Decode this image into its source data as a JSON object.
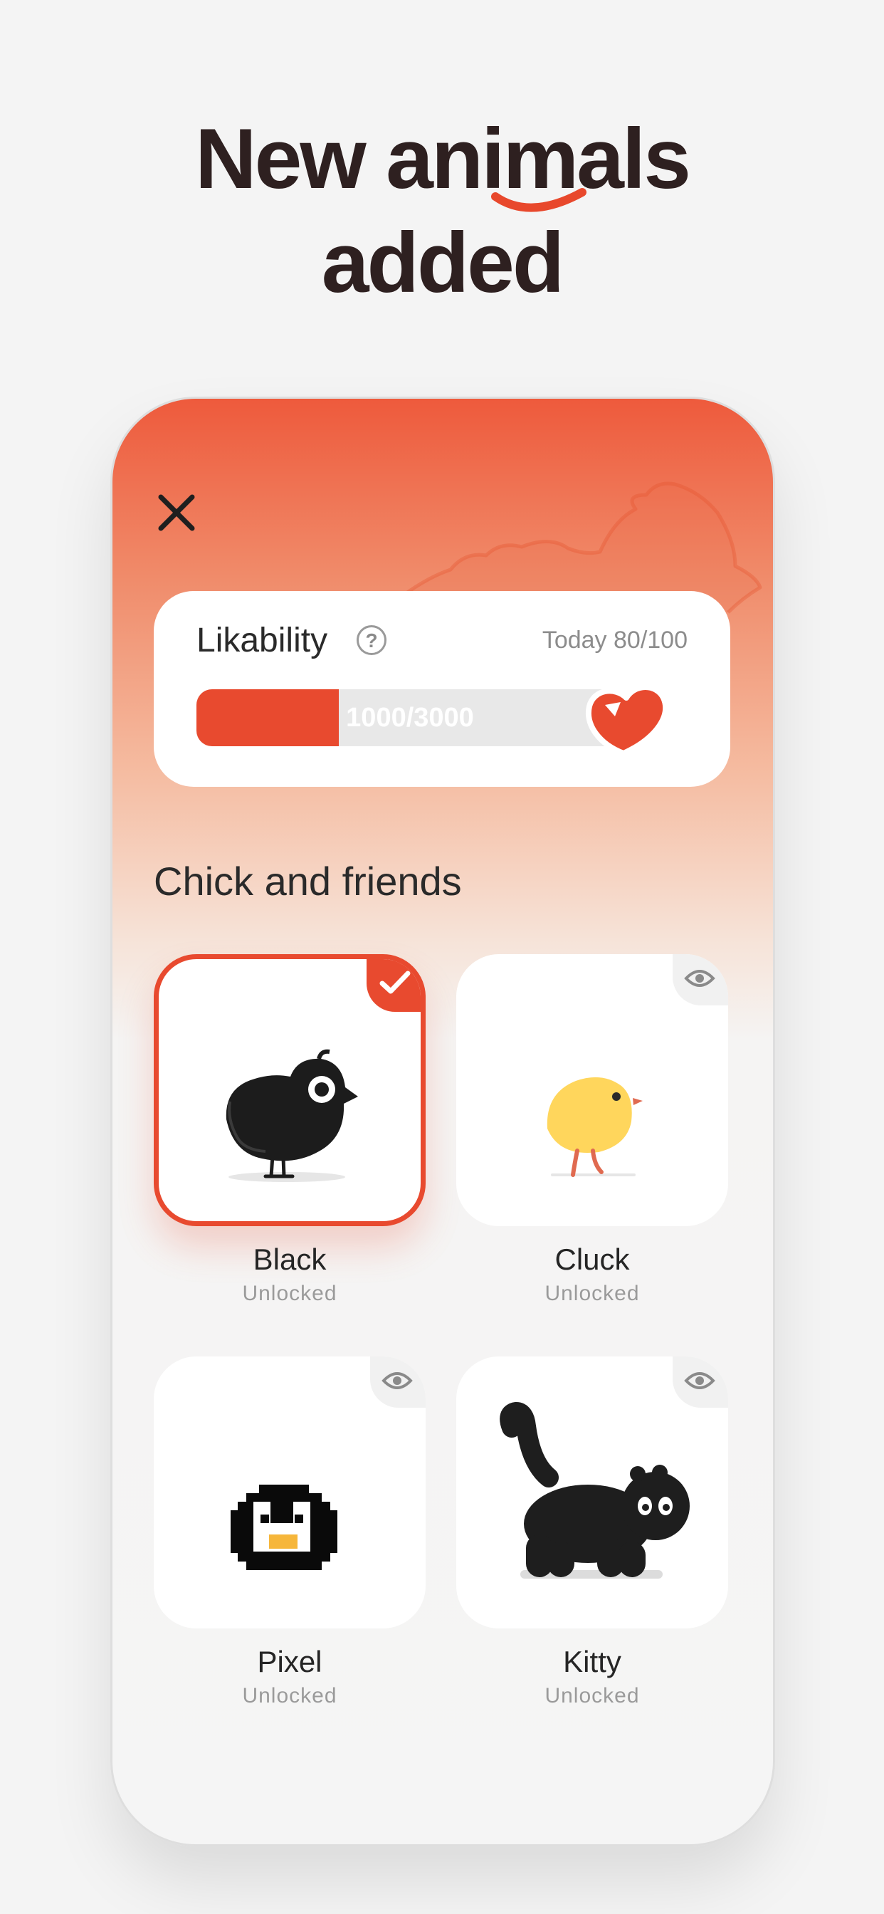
{
  "headline": {
    "line1": "New animals",
    "line2": "added"
  },
  "likability": {
    "title": "Likability",
    "today_label": "Today 80/100",
    "progress_text": "1000/3000",
    "progress_fraction": 0.3333
  },
  "section_title": "Chick and friends",
  "animals": [
    {
      "name": "Black",
      "status": "Unlocked",
      "selected": true
    },
    {
      "name": "Cluck",
      "status": "Unlocked",
      "selected": false
    },
    {
      "name": "Pixel",
      "status": "Unlocked",
      "selected": false
    },
    {
      "name": "Kitty",
      "status": "Unlocked",
      "selected": false
    }
  ],
  "icons": {
    "close": "close-icon",
    "help": "question-icon",
    "heart": "heart-icon",
    "check": "check-icon",
    "preview": "eye-icon"
  },
  "colors": {
    "accent": "#e84a2f",
    "text": "#2e2020"
  }
}
